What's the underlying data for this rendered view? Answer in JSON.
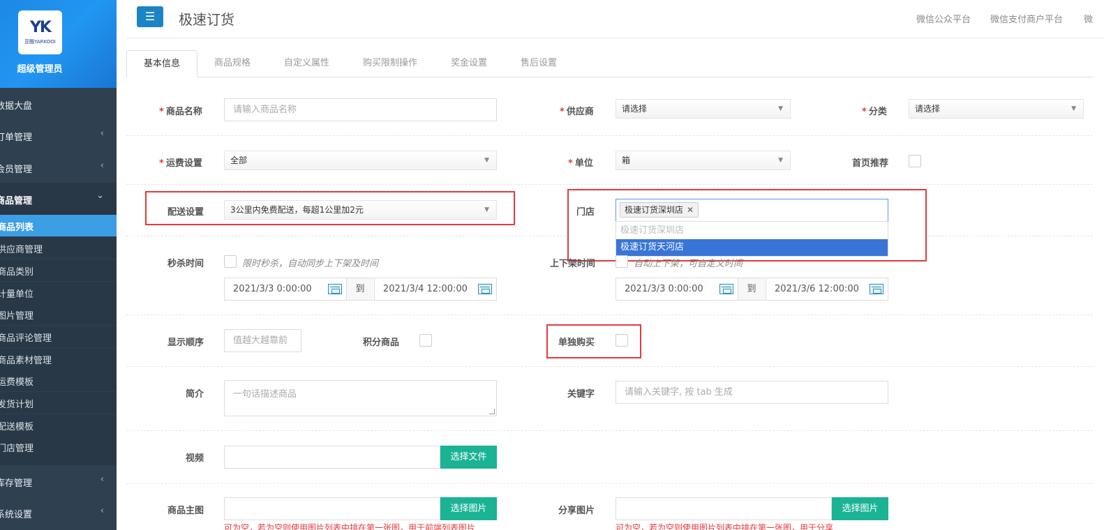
{
  "sidebar": {
    "logo_mark": "YK",
    "logo_text": "亚酷YARKOOI",
    "role": "超级管理员",
    "items": [
      {
        "label": "数据大盘",
        "arrow": ""
      },
      {
        "label": "订单管理",
        "arrow": "‹"
      },
      {
        "label": "会员管理",
        "arrow": "‹"
      },
      {
        "label": "商品管理",
        "arrow": "⌄"
      }
    ],
    "sub_items": [
      "商品列表",
      "供应商管理",
      "商品类别",
      "计量单位",
      "图片管理",
      "商品评论管理",
      "商品素材管理",
      "运费模板",
      "发货计划",
      "配送模板",
      "门店管理"
    ],
    "bottom_items": [
      {
        "label": "库存管理",
        "arrow": "‹"
      },
      {
        "label": "系统设置",
        "arrow": "‹"
      }
    ]
  },
  "header": {
    "menu_icon": "☰",
    "title": "极速订货",
    "links": [
      "微信公众平台",
      "微信支付商户平台",
      "微"
    ]
  },
  "tabs": [
    "基本信息",
    "商品规格",
    "自定义属性",
    "购买限制操作",
    "奖金设置",
    "售后设置"
  ],
  "form": {
    "name_label": "商品名称",
    "name_placeholder": "请输入商品名称",
    "supplier_label": "供应商",
    "supplier_value": "请选择",
    "category_label": "分类",
    "category_value": "请选择",
    "freight_label": "运费设置",
    "freight_value": "全部",
    "unit_label": "单位",
    "unit_value": "箱",
    "home_rec_label": "首页推荐",
    "delivery_label": "配送设置",
    "delivery_value": "3公里内免费配送，每超1公里加2元",
    "store_label": "门店",
    "store_tag": "极速订货深圳店",
    "store_options": [
      "极速订货深圳店",
      "极速订货天河店"
    ],
    "flash_label": "秒杀时间",
    "flash_hint": "限时秒杀，自动同步上下架及时间",
    "flash_start": "2021/3/3 0:00:00",
    "flash_end": "2021/3/4 12:00:00",
    "to_text": "到",
    "shelf_label": "上下架时间",
    "shelf_hint": "自动上下架，可自定义时间",
    "shelf_start": "2021/3/3 0:00:00",
    "shelf_end": "2021/3/6 12:00:00",
    "order_label": "显示顺序",
    "order_placeholder": "值越大越靠前",
    "points_label": "积分商品",
    "single_label": "单独购买",
    "intro_label": "简介",
    "intro_placeholder": "一句话描述商品",
    "keyword_label": "关键字",
    "keyword_placeholder": "请输入关键字, 按 tab 生成",
    "video_label": "视频",
    "choose_file": "选择文件",
    "main_img_label": "商品主图",
    "choose_image": "选择图片",
    "share_img_label": "分享图片",
    "main_img_note": "可为空，若为空则使用图片列表中排在第一张图，用于前端列表图片",
    "share_img_note": "可为空，若为空则使用图片列表中排在第一张图，用于分享"
  },
  "colors": {
    "sidebar_bg": "#2f4050",
    "active_blue": "#3c9ee5",
    "green": "#1ab394",
    "required_red": "#e4393c"
  }
}
